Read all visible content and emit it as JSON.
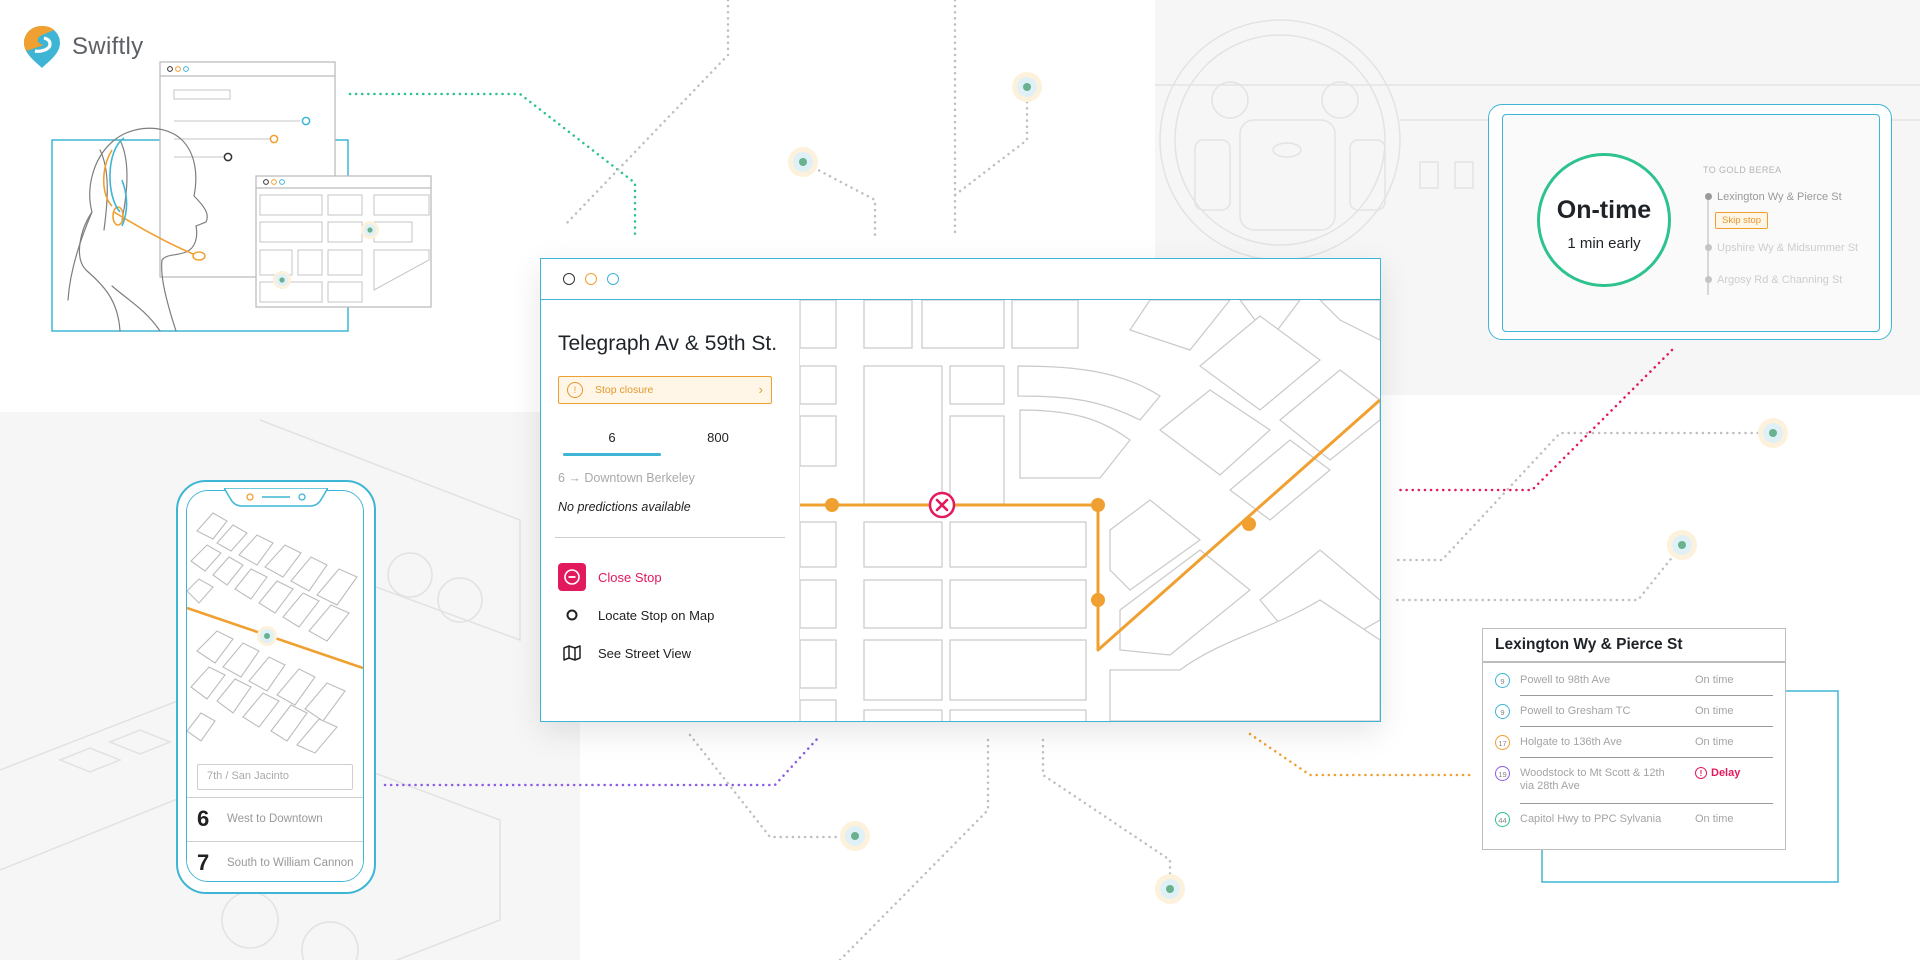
{
  "brand": {
    "name": "Swiftly",
    "colors": {
      "orange": "#f0a030",
      "teal": "#3eb5d4",
      "magenta": "#e3195e",
      "green": "#2ec28d",
      "purple": "#8c5ce6"
    }
  },
  "main_window": {
    "stop_title": "Telegraph Av & 59th St.",
    "alert": {
      "label": "Stop closure",
      "icon": "alert-circle-icon"
    },
    "tabs": [
      {
        "label": "6",
        "selected": true
      },
      {
        "label": "800",
        "selected": false
      }
    ],
    "route_line": "6 → Downtown Berkeley",
    "no_predictions": "No predictions available",
    "actions": [
      {
        "label": "Close Stop",
        "icon": "minus-circle-icon"
      },
      {
        "label": "Locate Stop on Map",
        "icon": "circle-icon"
      },
      {
        "label": "See Street View",
        "icon": "map-icon"
      }
    ]
  },
  "status_card": {
    "status": "On-time",
    "detail": "1 min early",
    "direction_label": "TO GOLD BEREA",
    "stops": [
      {
        "name": "Lexington Wy & Pierce St",
        "current": true
      },
      {
        "name": "Upshire Wy & Midsummer St",
        "current": false
      },
      {
        "name": "Argosy Rd & Channing St",
        "current": false
      }
    ],
    "skip_button": "Skip stop"
  },
  "phone": {
    "search_placeholder": "7th / San Jacinto",
    "routes": [
      {
        "number": "6",
        "destination": "West to Downtown"
      },
      {
        "number": "7",
        "destination": "South to William Cannon"
      }
    ]
  },
  "arrivals": {
    "title": "Lexington Wy & Pierce St",
    "rows": [
      {
        "route": "9",
        "destination": "Powell to 98th Ave",
        "status": "On time",
        "color": "#3eb5d4"
      },
      {
        "route": "9",
        "destination": "Powell to Gresham TC",
        "status": "On time",
        "color": "#3eb5d4"
      },
      {
        "route": "17",
        "destination": "Holgate to 136th Ave",
        "status": "On time",
        "color": "#f0a030"
      },
      {
        "route": "19",
        "destination": "Woodstock to Mt Scott & 12th via 28th Ave",
        "status": "Delay",
        "color": "#8c5ce6"
      },
      {
        "route": "44",
        "destination": "Capitol Hwy to PPC Sylvania",
        "status": "On time",
        "color": "#2ec28d"
      }
    ]
  }
}
